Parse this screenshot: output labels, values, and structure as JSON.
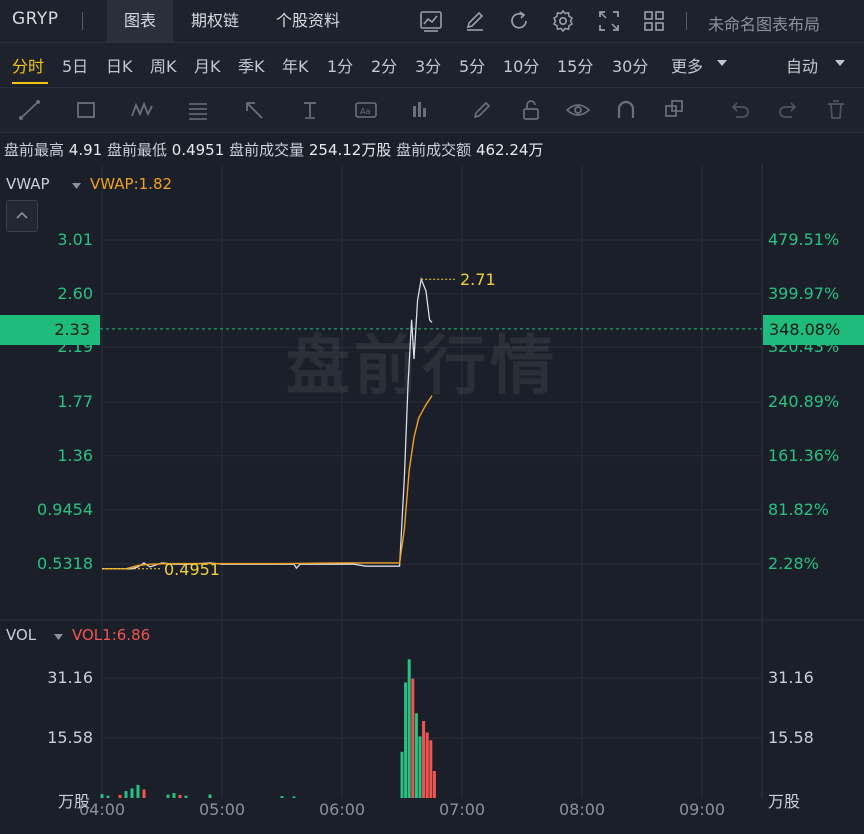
{
  "header": {
    "ticker": "GRYP",
    "tabs": [
      {
        "label": "图表",
        "active": true
      },
      {
        "label": "期权链",
        "active": false
      },
      {
        "label": "个股资料",
        "active": false
      }
    ],
    "layout_name": "未命名图表布局",
    "icons": [
      "line-chart-icon",
      "edit-icon",
      "refresh-icon",
      "settings-icon",
      "fullscreen-icon",
      "grid-layout-icon"
    ]
  },
  "periods": {
    "items": [
      "分时",
      "5日",
      "日K",
      "周K",
      "月K",
      "季K",
      "年K",
      "1分",
      "2分",
      "3分",
      "5分",
      "10分",
      "15分",
      "30分",
      "更多"
    ],
    "active": "分时",
    "mode": "自动"
  },
  "tools": [
    "draw-line-icon",
    "rectangle-icon",
    "wave-pattern-icon",
    "fibonacci-icon",
    "arrow-icon",
    "text-tool-icon",
    "label-icon",
    "bar-tool-icon",
    "pencil-icon",
    "lock-icon",
    "eye-icon",
    "magnet-icon",
    "layers-icon",
    "undo-icon",
    "redo-icon",
    "trash-icon"
  ],
  "premarket": {
    "high_label": "盘前最高",
    "high": "4.91",
    "low_label": "盘前最低",
    "low": "0.4951",
    "volume_label": "盘前成交量",
    "volume": "254.12万股",
    "amount_label": "盘前成交额",
    "amount": "462.24万"
  },
  "main_chart": {
    "indicator": "VWAP",
    "indicator_value": "VWAP:1.82",
    "watermark": "盘前行情",
    "current_price": "2.33",
    "current_pct": "348.08%",
    "high_marker": "2.71",
    "low_marker": "0.4951",
    "colors": {
      "price_line": "#d9dce2",
      "vwap_line": "#f0a020",
      "up": "#27c281",
      "down": "#f0554f",
      "marker": "#f0d03c"
    }
  },
  "volume_chart": {
    "indicator": "VOL",
    "indicator_value": "VOL1:6.86",
    "unit": "万股"
  },
  "chart_data": {
    "type": "line",
    "title": "",
    "x": [
      "04:00",
      "05:00",
      "06:00",
      "07:00",
      "08:00",
      "09:00"
    ],
    "y_ticks": [
      "3.01",
      "2.60",
      "2.19",
      "1.77",
      "1.36",
      "0.9454",
      "0.5318"
    ],
    "pct_ticks": [
      "479.51%",
      "399.97%",
      "320.43%",
      "240.89%",
      "161.36%",
      "81.82%",
      "2.28%"
    ],
    "vol_ticks": [
      "31.16",
      "15.58"
    ],
    "ylim": [
      0.4951,
      3.01
    ],
    "series": [
      {
        "values": [
          [
            0,
            0.495
          ],
          [
            0.1,
            0.495
          ],
          [
            0.2,
            0.495
          ],
          [
            0.25,
            0.495
          ],
          [
            0.3,
            0.51
          ],
          [
            0.35,
            0.54
          ],
          [
            0.4,
            0.51
          ],
          [
            0.5,
            0.54
          ],
          [
            0.6,
            0.53
          ],
          [
            0.75,
            0.53
          ],
          [
            0.9,
            0.54
          ],
          [
            1.0,
            0.53
          ],
          [
            1.2,
            0.53
          ],
          [
            1.4,
            0.53
          ],
          [
            1.5,
            0.53
          ],
          [
            1.6,
            0.53
          ],
          [
            1.62,
            0.5
          ],
          [
            1.65,
            0.53
          ],
          [
            1.8,
            0.53
          ],
          [
            2.0,
            0.53
          ],
          [
            2.1,
            0.53
          ],
          [
            2.2,
            0.515
          ],
          [
            2.3,
            0.515
          ],
          [
            2.48,
            0.515
          ],
          [
            2.52,
            1.2
          ],
          [
            2.55,
            1.9
          ],
          [
            2.58,
            2.4
          ],
          [
            2.6,
            2.1
          ],
          [
            2.63,
            2.55
          ],
          [
            2.66,
            2.71
          ],
          [
            2.7,
            2.62
          ],
          [
            2.73,
            2.4
          ],
          [
            2.75,
            2.38
          ]
        ]
      },
      {
        "values": [
          [
            0,
            0.495
          ],
          [
            0.2,
            0.495
          ],
          [
            0.3,
            0.52
          ],
          [
            0.4,
            0.53
          ],
          [
            0.6,
            0.535
          ],
          [
            1.0,
            0.535
          ],
          [
            1.5,
            0.535
          ],
          [
            2.0,
            0.54
          ],
          [
            2.48,
            0.54
          ],
          [
            2.52,
            0.8
          ],
          [
            2.56,
            1.25
          ],
          [
            2.6,
            1.5
          ],
          [
            2.64,
            1.65
          ],
          [
            2.7,
            1.75
          ],
          [
            2.75,
            1.82
          ]
        ]
      }
    ],
    "volume": [
      {
        "t": 0.0,
        "v": 1.0,
        "up": true
      },
      {
        "t": 0.05,
        "v": 0.6,
        "up": true
      },
      {
        "t": 0.15,
        "v": 0.8,
        "up": false
      },
      {
        "t": 0.2,
        "v": 1.8,
        "up": true
      },
      {
        "t": 0.25,
        "v": 2.5,
        "up": true
      },
      {
        "t": 0.3,
        "v": 3.4,
        "up": true
      },
      {
        "t": 0.35,
        "v": 2.2,
        "up": false
      },
      {
        "t": 0.55,
        "v": 0.9,
        "up": true
      },
      {
        "t": 0.6,
        "v": 1.3,
        "up": true
      },
      {
        "t": 0.65,
        "v": 0.8,
        "up": false
      },
      {
        "t": 0.7,
        "v": 0.6,
        "up": true
      },
      {
        "t": 0.9,
        "v": 0.9,
        "up": true
      },
      {
        "t": 1.5,
        "v": 0.5,
        "up": true
      },
      {
        "t": 1.6,
        "v": 0.4,
        "up": true
      },
      {
        "t": 2.5,
        "v": 12,
        "up": true
      },
      {
        "t": 2.53,
        "v": 30,
        "up": true
      },
      {
        "t": 2.56,
        "v": 36,
        "up": true
      },
      {
        "t": 2.59,
        "v": 31,
        "up": false
      },
      {
        "t": 2.62,
        "v": 22,
        "up": true
      },
      {
        "t": 2.65,
        "v": 16,
        "up": true
      },
      {
        "t": 2.68,
        "v": 20,
        "up": false
      },
      {
        "t": 2.71,
        "v": 17,
        "up": false
      },
      {
        "t": 2.74,
        "v": 15,
        "up": false
      },
      {
        "t": 2.77,
        "v": 7,
        "up": false
      }
    ]
  }
}
